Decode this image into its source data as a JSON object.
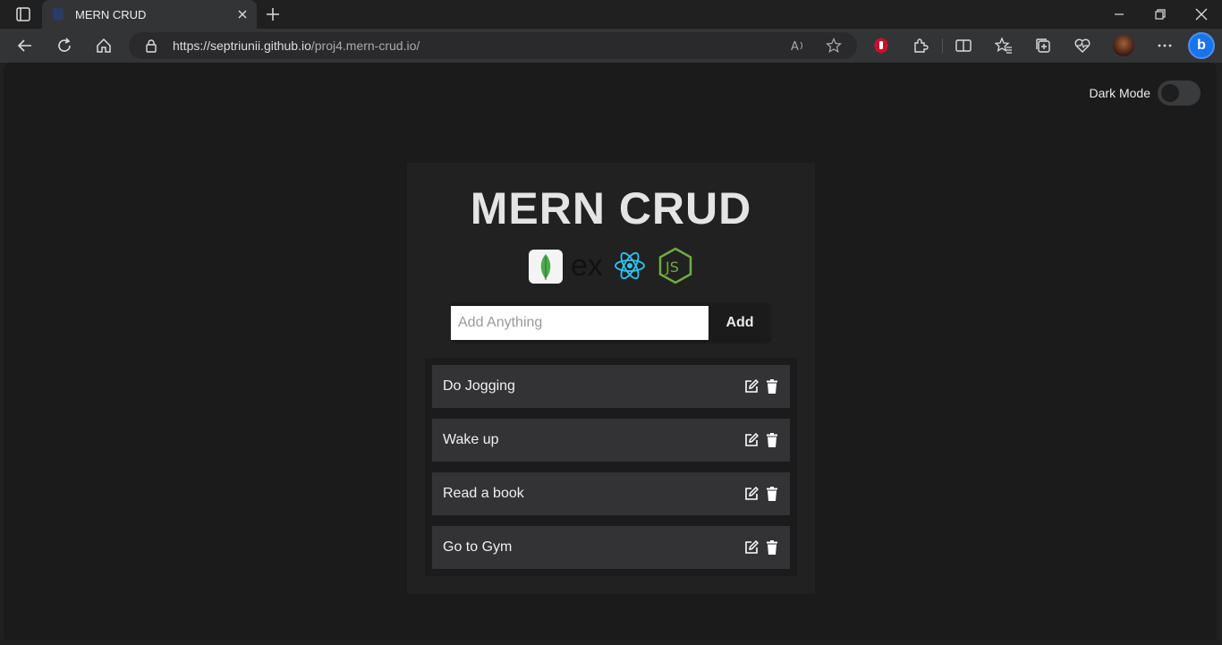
{
  "browser": {
    "tab_title": "MERN CRUD",
    "url_host": "https://septriunii.github.io",
    "url_path": "/proj4.mern-crud.io/"
  },
  "page": {
    "dark_mode_label": "Dark Mode",
    "dark_mode_on": false,
    "title": "MERN CRUD",
    "logo_ex_text": "ex",
    "input_placeholder": "Add Anything",
    "input_value": "",
    "add_button": "Add",
    "todos": [
      {
        "text": "Do Jogging"
      },
      {
        "text": "Wake up"
      },
      {
        "text": "Read a book"
      },
      {
        "text": "Go to Gym"
      }
    ]
  },
  "icons": {
    "tab_actions": "tab-actions-icon",
    "back": "back-arrow-icon",
    "refresh": "refresh-icon",
    "home": "home-icon",
    "lock": "lock-icon",
    "read_aloud": "read-aloud-icon",
    "favorite": "star-icon",
    "extensions": "puzzle-icon",
    "split": "split-screen-icon",
    "favorites": "favorites-icon",
    "collections": "collections-icon",
    "performance": "heart-pulse-icon",
    "menu": "more-icon",
    "edit": "edit-icon",
    "delete": "trash-icon"
  },
  "colors": {
    "page_bg": "#1b1b1c",
    "card_bg": "#212122",
    "item_bg": "#333336",
    "mongo_green": "#4fa94d",
    "react_blue": "#2ec4f1",
    "node_green": "#6dae3f"
  }
}
